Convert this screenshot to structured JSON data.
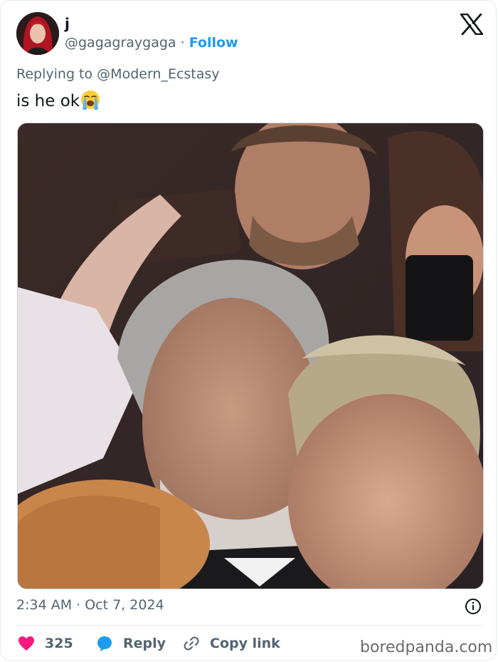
{
  "tweet": {
    "display_name": "j",
    "handle": "@gagagraygaga",
    "separator": "·",
    "follow_label": "Follow",
    "replying_prefix": "Replying to",
    "replying_to": "@Modern_Ecstasy",
    "text": "is he ok",
    "emoji": "loudly-crying-face",
    "timestamp": "2:34 AM · Oct 7, 2024"
  },
  "media": {
    "kind": "photo",
    "description_icon": "photo-crowd-scene"
  },
  "actions": {
    "like_count": "325",
    "reply_label": "Reply",
    "copy_link_label": "Copy link"
  },
  "watermark": "boredpanda.com",
  "colors": {
    "accent": "#1d9bf0",
    "like": "#f91880",
    "muted": "#536471",
    "text": "#0f1419"
  }
}
